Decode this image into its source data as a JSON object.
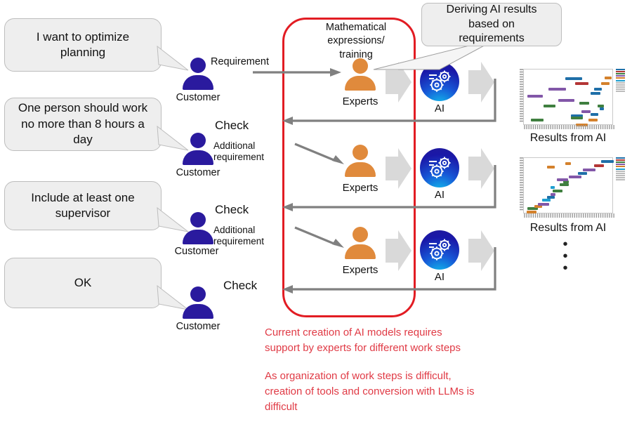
{
  "diagram": {
    "title_present": false,
    "colors": {
      "customer_navy": "#2a1a9e",
      "expert_orange": "#e08a3c",
      "red_frame": "#e21c23",
      "red_text": "#e03a45",
      "arrow_gray": "#808080",
      "chevron_gray": "#d9d9d9",
      "bubble_fill": "#eeeeee",
      "bubble_stroke": "#bdbdbd"
    }
  },
  "bubbles": [
    {
      "id": "bubble-1",
      "text": "I want to optimize planning"
    },
    {
      "id": "bubble-2",
      "text": "One person should work no more than 8 hours a day"
    },
    {
      "id": "bubble-3",
      "text": "Include at least one supervisor"
    },
    {
      "id": "bubble-4",
      "text": "OK"
    }
  ],
  "customers": [
    {
      "id": "customer-1",
      "label": "Customer",
      "action": "Requirement",
      "check": ""
    },
    {
      "id": "customer-2",
      "label": "Customer",
      "action": "Additional requirement",
      "check": "Check"
    },
    {
      "id": "customer-3",
      "label": "Customer",
      "action": "Additional requirement",
      "check": "Check"
    },
    {
      "id": "customer-4",
      "label": "Customer",
      "action": "",
      "check": "Check"
    }
  ],
  "process": {
    "header": "Mathematical expressions/ training",
    "header_lines": [
      "Mathematical",
      "expressions/",
      "training"
    ],
    "rows": [
      {
        "expert_label": "Experts",
        "ai_label": "AI"
      },
      {
        "expert_label": "Experts",
        "ai_label": "AI"
      },
      {
        "expert_label": "Experts",
        "ai_label": "AI"
      }
    ]
  },
  "callout": {
    "id": "callout-deriving",
    "text": "Deriving AI results based on requirements",
    "lines": [
      "Deriving AI results",
      "based on",
      "requirements"
    ]
  },
  "results": [
    {
      "id": "result-1",
      "caption": "Results from AI"
    },
    {
      "id": "result-2",
      "caption": "Results from AI"
    }
  ],
  "ellipsis": "•\n•\n•",
  "notes": [
    {
      "id": "note-1",
      "text": "Current creation of AI models requires\nsupport by experts for different work steps"
    },
    {
      "id": "note-2",
      "text": "As organization of work steps is difficult,\ncreation of tools and conversion with LLMs is\ndifficult"
    }
  ],
  "chart_data": [
    {
      "type": "scatter",
      "title": "Results from AI",
      "xlabel": "",
      "ylabel": "",
      "grid": false,
      "legend": "right",
      "note": "Gantt-like scattered horizontal bars, unordered",
      "bars": [
        {
          "x": 8,
          "y": 88,
          "w": 14,
          "color": "#3f7f3f"
        },
        {
          "x": 22,
          "y": 62,
          "w": 13,
          "color": "#3f7f3f"
        },
        {
          "x": 4,
          "y": 45,
          "w": 17,
          "color": "#8257a8"
        },
        {
          "x": 27,
          "y": 33,
          "w": 20,
          "color": "#8257a8"
        },
        {
          "x": 38,
          "y": 52,
          "w": 18,
          "color": "#8257a8"
        },
        {
          "x": 46,
          "y": 14,
          "w": 19,
          "color": "#1f6fa8"
        },
        {
          "x": 57,
          "y": 22,
          "w": 15,
          "color": "#b33636"
        },
        {
          "x": 52,
          "y": 80,
          "w": 14,
          "color": "#1f6fa8"
        },
        {
          "x": 52,
          "y": 84,
          "w": 14,
          "color": "#3f7f3f"
        },
        {
          "x": 58,
          "y": 96,
          "w": 13,
          "color": "#d4812c"
        },
        {
          "x": 62,
          "y": 58,
          "w": 11,
          "color": "#3f7f3f"
        },
        {
          "x": 64,
          "y": 72,
          "w": 10,
          "color": "#8257a8"
        },
        {
          "x": 74,
          "y": 40,
          "w": 11,
          "color": "#1f6fa8"
        },
        {
          "x": 78,
          "y": 32,
          "w": 9,
          "color": "#1f6fa8"
        },
        {
          "x": 74,
          "y": 78,
          "w": 9,
          "color": "#1f6fa8"
        },
        {
          "x": 72,
          "y": 88,
          "w": 10,
          "color": "#d4812c"
        },
        {
          "x": 82,
          "y": 62,
          "w": 7,
          "color": "#3f7f3f"
        },
        {
          "x": 84,
          "y": 68,
          "w": 5,
          "color": "#1f6fa8"
        },
        {
          "x": 86,
          "y": 22,
          "w": 9,
          "color": "#d4812c"
        },
        {
          "x": 90,
          "y": 12,
          "w": 8,
          "color": "#d4812c"
        }
      ]
    },
    {
      "type": "scatter",
      "title": "Results from AI",
      "xlabel": "",
      "ylabel": "",
      "grid": false,
      "legend": "right",
      "note": "Diagonal staircase of horizontal bars, ordered schedule",
      "bars": [
        {
          "x": 3,
          "y": 94,
          "w": 11,
          "color": "#d4812c"
        },
        {
          "x": 4,
          "y": 88,
          "w": 12,
          "color": "#3f7f3f"
        },
        {
          "x": 12,
          "y": 84,
          "w": 8,
          "color": "#d4812c"
        },
        {
          "x": 16,
          "y": 80,
          "w": 12,
          "color": "#8257a8"
        },
        {
          "x": 20,
          "y": 73,
          "w": 10,
          "color": "#1f9fd0"
        },
        {
          "x": 26,
          "y": 68,
          "w": 8,
          "color": "#1f6fa8"
        },
        {
          "x": 30,
          "y": 62,
          "w": 5,
          "color": "#8257a8"
        },
        {
          "x": 32,
          "y": 56,
          "w": 11,
          "color": "#3f7f3f"
        },
        {
          "x": 30,
          "y": 50,
          "w": 4,
          "color": "#1f9fd0"
        },
        {
          "x": 40,
          "y": 45,
          "w": 10,
          "color": "#3f7f3f"
        },
        {
          "x": 44,
          "y": 40,
          "w": 6,
          "color": "#3f7f3f"
        },
        {
          "x": 37,
          "y": 36,
          "w": 12,
          "color": "#8257a8"
        },
        {
          "x": 50,
          "y": 31,
          "w": 14,
          "color": "#8257a8"
        },
        {
          "x": 60,
          "y": 25,
          "w": 10,
          "color": "#1f6fa8"
        },
        {
          "x": 66,
          "y": 19,
          "w": 14,
          "color": "#8257a8"
        },
        {
          "x": 26,
          "y": 14,
          "w": 8,
          "color": "#d4812c"
        },
        {
          "x": 46,
          "y": 7,
          "w": 6,
          "color": "#d4812c"
        },
        {
          "x": 78,
          "y": 11,
          "w": 11,
          "color": "#b33636"
        },
        {
          "x": 86,
          "y": 4,
          "w": 14,
          "color": "#1f6fa8"
        }
      ]
    }
  ]
}
